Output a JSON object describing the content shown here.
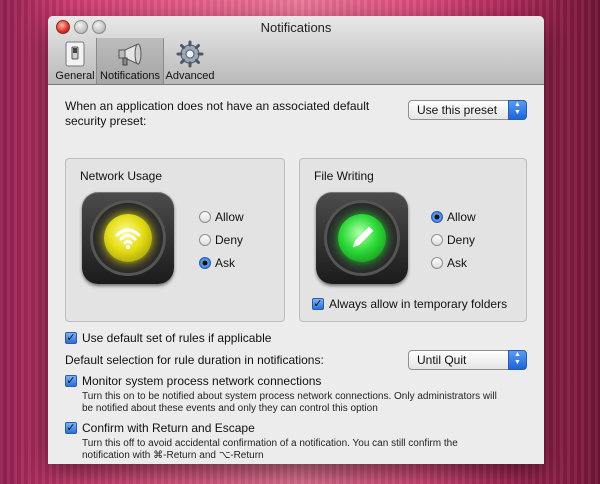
{
  "window": {
    "title": "Notifications"
  },
  "tabs": [
    {
      "label": "General",
      "icon": "switch-icon"
    },
    {
      "label": "Notifications",
      "icon": "megaphone-icon"
    },
    {
      "label": "Advanced",
      "icon": "gear-icon"
    }
  ],
  "default_preset": {
    "label_line1": "When an application does not have an associated default",
    "label_line2": "security preset:",
    "value": "Use this preset"
  },
  "network_usage": {
    "title": "Network Usage",
    "icon": "wifi-icon",
    "lamp_color": "#e4dd15",
    "options": [
      "Allow",
      "Deny",
      "Ask"
    ],
    "selected": "Ask"
  },
  "file_writing": {
    "title": "File Writing",
    "icon": "pencil-icon",
    "lamp_color": "#2ddb37",
    "options": [
      "Allow",
      "Deny",
      "Ask"
    ],
    "selected": "Allow",
    "temp_folders_label": "Always allow in temporary folders",
    "temp_folders_checked": true
  },
  "default_rules": {
    "label": "Use default set of rules if applicable",
    "checked": true
  },
  "rule_duration": {
    "label": "Default selection for rule duration in notifications:",
    "value": "Until Quit"
  },
  "monitor_system": {
    "label": "Monitor system process network connections",
    "checked": true,
    "desc_line1": "Turn this on to be notified about system process network connections. Only administrators will",
    "desc_line2": "be notified about these events and only they can control this option"
  },
  "confirm_keys": {
    "label": "Confirm with Return and Escape",
    "checked": true,
    "desc_line1": "Turn this off to avoid accidental confirmation of a notification. You can still confirm the",
    "desc_line2": "notification with ⌘-Return and ⌥-Return"
  },
  "colors": {
    "accent": "#2b6fd8",
    "window_bg": "#ececec"
  }
}
